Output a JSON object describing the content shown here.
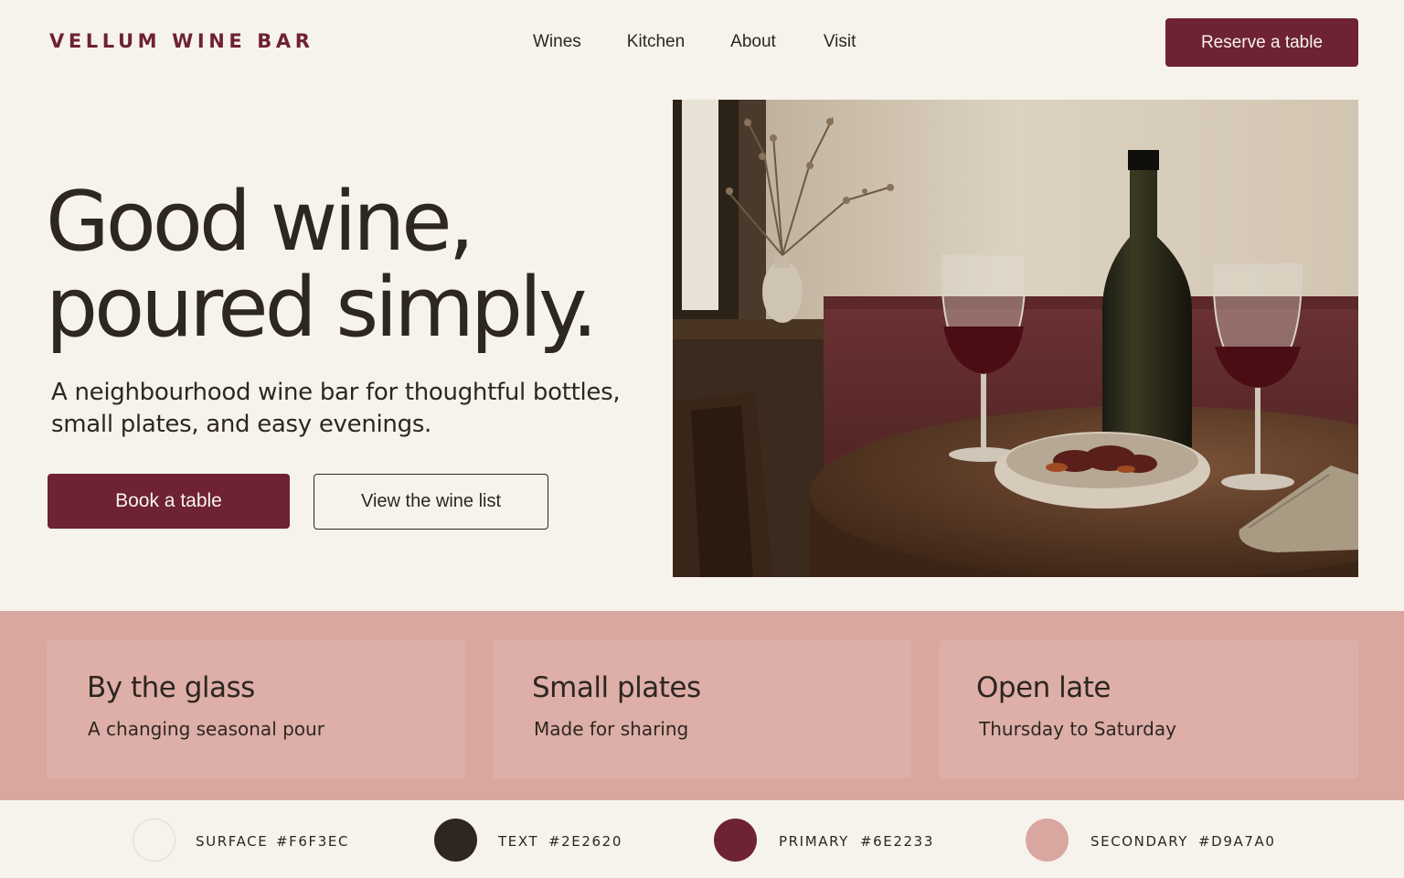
{
  "brand": {
    "name": "VELLUM WINE BAR"
  },
  "nav": {
    "items": [
      "Wines",
      "Kitchen",
      "About",
      "Visit"
    ]
  },
  "header": {
    "cta_label": "Reserve a table"
  },
  "hero": {
    "headline_line1": "Good wine,",
    "headline_line2": "poured simply.",
    "subtitle": "A neighbourhood wine bar for thoughtful bottles, small plates, and easy evenings.",
    "primary_cta": "Book a table",
    "secondary_cta": "View the wine list"
  },
  "features": [
    {
      "title": "By the glass",
      "text": "A changing seasonal pour"
    },
    {
      "title": "Small plates",
      "text": "Made for sharing"
    },
    {
      "title": "Open late",
      "text": "Thursday to Saturday"
    }
  ],
  "palette": [
    {
      "name": "SURFACE",
      "hex": "#F6F3EC",
      "hex_label": "#F6F3EC"
    },
    {
      "name": "TEXT",
      "hex": "#2E2620",
      "hex_label": "#2E2620"
    },
    {
      "name": "PRIMARY",
      "hex": "#6E2233",
      "hex_label": "#6E2233"
    },
    {
      "name": "SECONDARY",
      "hex": "#D9A7A0",
      "hex_label": "#D9A7A0"
    }
  ],
  "colors": {
    "surface": "#F6F3EC",
    "text": "#2E2620",
    "primary": "#6E2233",
    "secondary": "#D9A7A0"
  }
}
